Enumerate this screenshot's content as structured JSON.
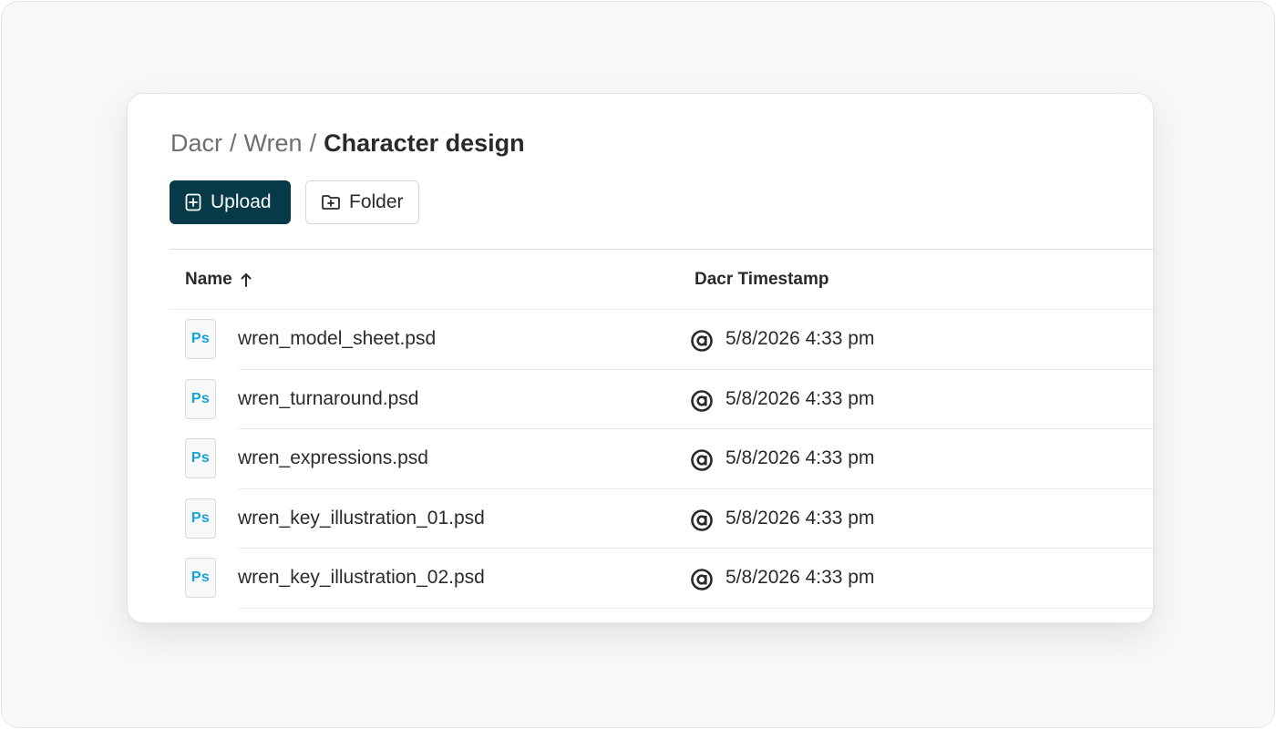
{
  "breadcrumb": {
    "items": [
      "Dacr",
      "Wren"
    ],
    "separator": "/",
    "current": "Character design"
  },
  "actions": {
    "upload_label": "Upload",
    "folder_label": "Folder"
  },
  "table": {
    "columns": {
      "name": "Name",
      "name_sort": "ascending",
      "timestamp": "Dacr Timestamp"
    },
    "rows": [
      {
        "icon_text": "Ps",
        "name": "wren_model_sheet.psd",
        "timestamp": "5/8/2026 4:33 pm"
      },
      {
        "icon_text": "Ps",
        "name": "wren_turnaround.psd",
        "timestamp": "5/8/2026 4:33 pm"
      },
      {
        "icon_text": "Ps",
        "name": "wren_expressions.psd",
        "timestamp": "5/8/2026 4:33 pm"
      },
      {
        "icon_text": "Ps",
        "name": "wren_key_illustration_01.psd",
        "timestamp": "5/8/2026 4:33 pm"
      },
      {
        "icon_text": "Ps",
        "name": "wren_key_illustration_02.psd",
        "timestamp": "5/8/2026 4:33 pm"
      }
    ]
  },
  "colors": {
    "primary_button": "#073a48",
    "ps_icon": "#16a2d8"
  },
  "icons": {
    "upload": "file-plus-icon",
    "folder": "folder-plus-icon",
    "sort": "arrow-up-icon",
    "file": "photoshop-file-icon",
    "timestamp": "dacr-logo-icon"
  }
}
